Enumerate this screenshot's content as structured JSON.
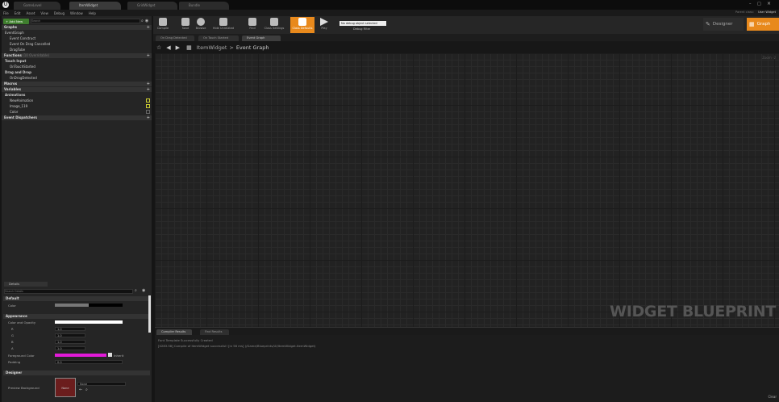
{
  "window": {
    "tabs": [
      "GameLevel",
      "ItemWidget",
      "GridWidget",
      "Bundle"
    ],
    "window_status": "Parent class:",
    "parent_class": "User Widget"
  },
  "menu": [
    "File",
    "Edit",
    "Asset",
    "View",
    "Debug",
    "Window",
    "Help"
  ],
  "my_blueprint": {
    "add_new_label": "+ Add New",
    "search_placeholder": "Search",
    "graphs_header": "Graphs",
    "event_graph_label": "EventGraph",
    "events": [
      "Event Construct",
      "Event On Drag Cancelled",
      "DragTube"
    ],
    "functions_header": "Functions",
    "functions_overridable": "(10 Overridable)",
    "touch_input_header": "Touch Input",
    "touch_input_items": [
      "OnTouchStarted"
    ],
    "drag_drop_header": "Drag and Drop",
    "drag_drop_items": [
      "OnDragDetected"
    ],
    "macros_header": "Macros",
    "variables_header": "Variables",
    "animations_header": "Animations",
    "animations": [
      "NewAnimation",
      "Image_119",
      "Color"
    ],
    "dispatchers_header": "Event Dispatchers"
  },
  "details": {
    "tab_label": "Details",
    "search_placeholder": "Search Details",
    "default_header": "Default",
    "color_label": "Color",
    "appearance_header": "Appearance",
    "color_opacity_label": "Color and Opacity",
    "channels": [
      {
        "label": "R",
        "value": "1.0"
      },
      {
        "label": "G",
        "value": "1.0"
      },
      {
        "label": "B",
        "value": "1.0"
      },
      {
        "label": "A",
        "value": "1.0"
      }
    ],
    "foreground_label": "Foreground Color",
    "inherit_label": "Inherit",
    "padding_label": "Padding",
    "padding_value": "0.0",
    "designer_header": "Designer",
    "preview_bg_label": "Preview Background",
    "preview_swatch_text": "None",
    "preview_select": "None"
  },
  "toolbar": {
    "buttons": [
      "Compile",
      "Save",
      "Browse",
      "Hide Unrelated",
      "Find",
      "Class Settings",
      "Class Defaults",
      "Play"
    ],
    "debug_select": "No debug object selected",
    "debug_filter_label": "Debug Filter",
    "designer_label": "Designer",
    "graph_label": "Graph"
  },
  "graph_tabs": [
    "On Drag Detected",
    "On Touch Started",
    "Event Graph"
  ],
  "breadcrumb": {
    "widget": "ItemWidget",
    "separator": ">",
    "graph": "Event Graph"
  },
  "graph": {
    "watermark": "WIDGET BLUEPRINT",
    "zoom": "Zoom -2"
  },
  "results": {
    "tabs": [
      "Compiler Results",
      "Find Results"
    ],
    "lines": [
      "Font Template Successfully Created",
      "[0283.58] Compile of ItemWidget successful! [in 56 ms] (/Game/Blueprints/UI/ItemWidget.ItemWidget)"
    ],
    "clear_label": "Clear"
  },
  "colors": {
    "accent": "#e8891c",
    "foreground": "#e21ad9"
  }
}
